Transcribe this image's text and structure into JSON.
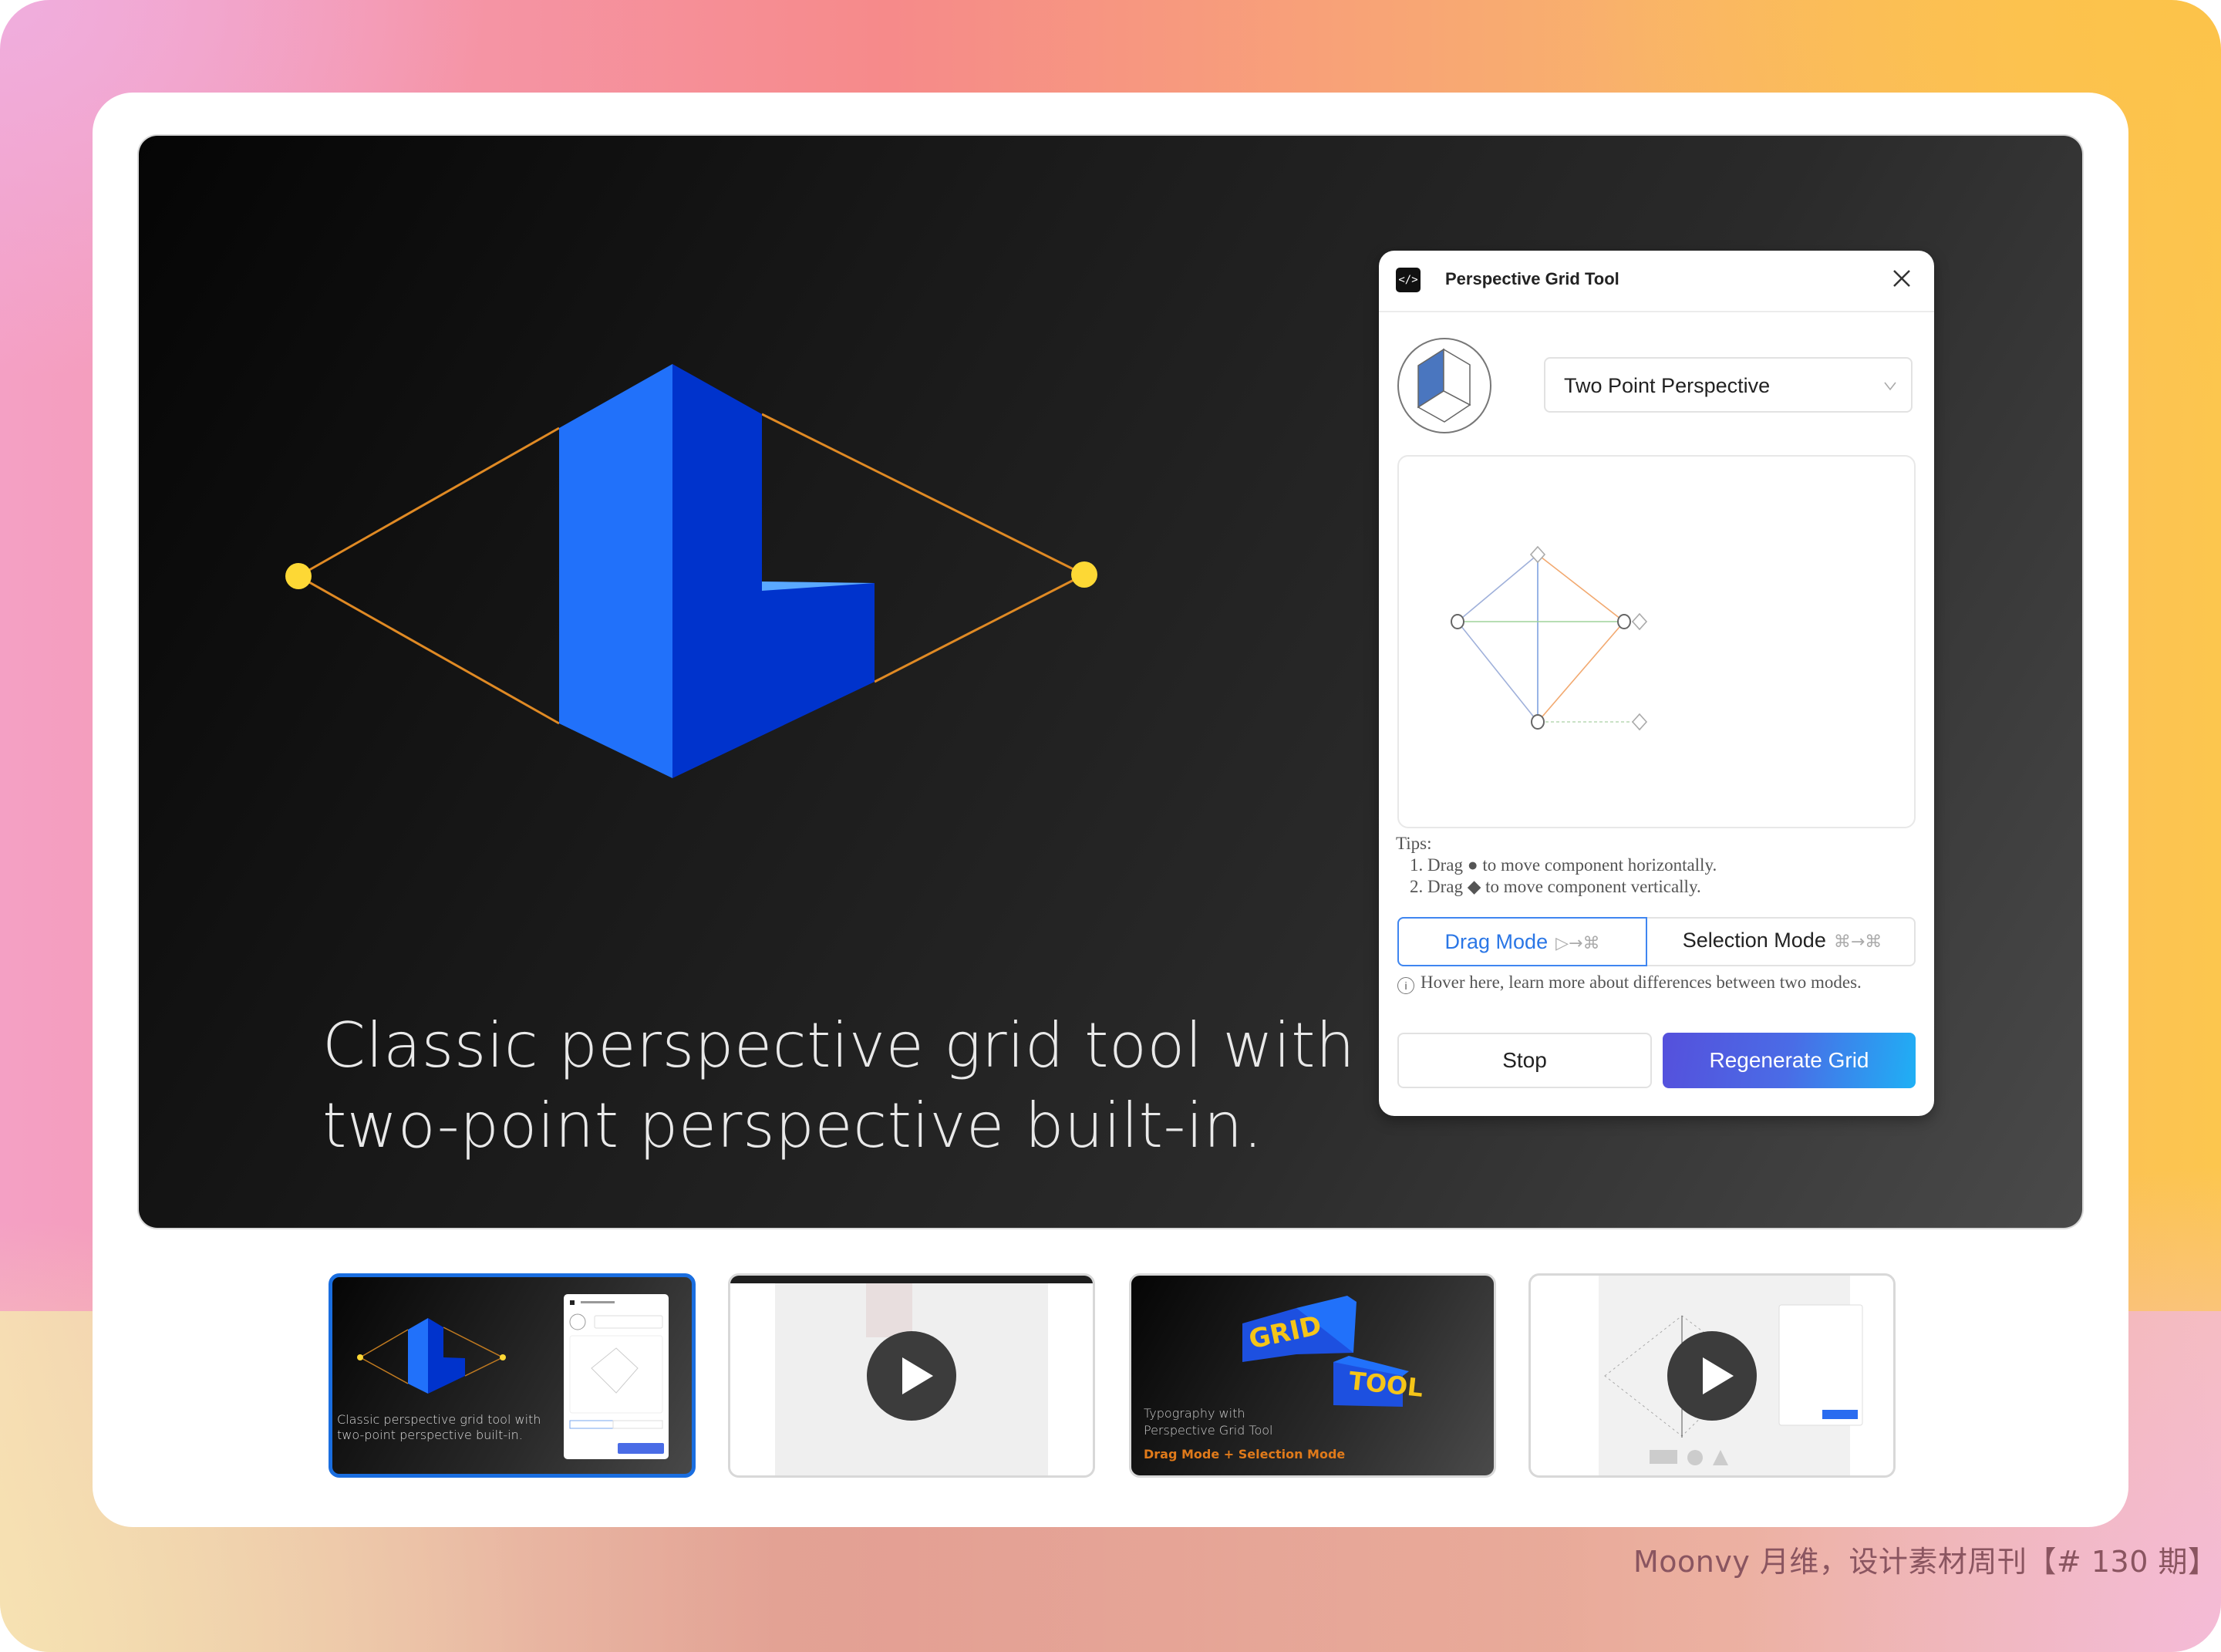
{
  "hero": {
    "headline": "Classic perspective grid tool with\ntwo-point perspective built-in.",
    "colors": {
      "block_light": "#2171fa",
      "block_dark": "#0033cc",
      "block_highlight": "#5aa9ff",
      "guide_line": "#e08a24",
      "vanishing_point": "#fdd835"
    }
  },
  "panel": {
    "title": "Perspective Grid Tool",
    "plugin_icon_glyph": "</>",
    "close_icon": "close-icon",
    "perspective_select": {
      "value": "Two Point Perspective"
    },
    "tips": {
      "heading": "Tips:",
      "items": [
        "1. Drag ● to move component horizontally.",
        "2. Drag ◆ to move component vertically."
      ]
    },
    "modes": {
      "drag": {
        "label": "Drag Mode",
        "glyph": "▷→⌘",
        "active": true
      },
      "selection": {
        "label": "Selection Mode",
        "glyph": "⌘→⌘",
        "active": false
      }
    },
    "hover_note": "Hover here, learn more about differences between two modes.",
    "buttons": {
      "stop": "Stop",
      "regenerate": "Regenerate Grid"
    },
    "accent_color": "#2a76e6"
  },
  "thumbnails": [
    {
      "label": "Classic perspective grid tool with two-point perspective built-in.",
      "type": "image",
      "selected": true
    },
    {
      "label": "",
      "type": "video",
      "selected": false
    },
    {
      "label": "Typography with Perspective Grid Tool",
      "sublabel": "Drag Mode + Selection Mode",
      "title_words": [
        "GRID",
        "TOOL"
      ],
      "type": "image",
      "selected": false
    },
    {
      "label": "",
      "type": "video",
      "selected": false
    }
  ],
  "footer": {
    "credit": "Moonvy 月维，设计素材周刊【# 130 期】"
  }
}
